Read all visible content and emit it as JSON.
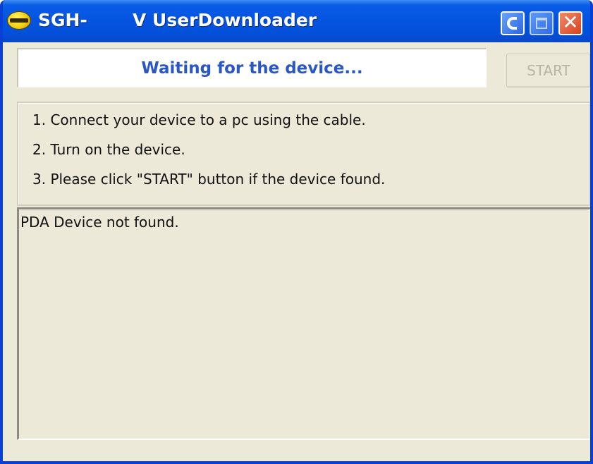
{
  "window": {
    "title_part1": "SGH-",
    "title_part2": "V UserDownloader",
    "controls": {
      "minimize_icon": "minimize-icon",
      "maximize_icon": "maximize-icon",
      "close_icon": "close-icon",
      "close_glyph": "✕"
    },
    "colors": {
      "titlebar": "#0453e0",
      "frame": "#ece9d8",
      "status_text": "#2a57c4"
    }
  },
  "status": {
    "message": "Waiting for the device..."
  },
  "toolbar": {
    "start_label": "START"
  },
  "instructions": [
    "1. Connect your device to a pc using the cable.",
    "2. Turn on the device.",
    "3. Please click \"START\" button if the device found."
  ],
  "log": {
    "lines": [
      "PDA Device not found."
    ]
  }
}
